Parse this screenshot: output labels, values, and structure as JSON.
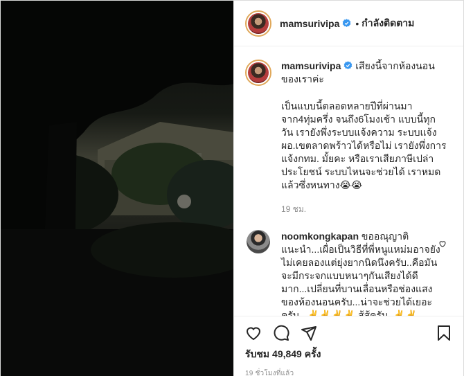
{
  "header": {
    "username": "mamsurivipa",
    "separator": "•",
    "follow_label": "กำลังติดตาม"
  },
  "caption": {
    "username": "mamsurivipa",
    "first_line": "เสียงนี้จากห้องนอนของเราค่ะ",
    "body": "เป็นแบบนี้ตลอดหลายปีที่ผ่านมา จาก4ทุ่มครึ่ง จนถึง6โมงเช้า แบบนี้ทุกวัน เรายังพึ่งระบบแจ้งความ ระบบแจ้งผอ.เขตลาดพร้าวได้หรือไม่ เรายังพึ่งการแจ้งกทม. มั้ยคะ หรือเราเสียภาษีเปล่าประโยชน์ ระบบไหนจะช่วยได้ เราหมดแล้วซึ่งหนทาง😭😭",
    "time": "19 ชม."
  },
  "comment": {
    "username": "noomkongkapan",
    "text": "ขออณุญาติแนะนำ...เผื่อเป็นวิธีที่พี่หนูแหม่มอาจยังไม่เคยลองแต่ยุ่งยากนิดนึงครับ..คือมันจะมีกระจกแบบหนาๆกันเสียงได้ดีมาก...เปลี่ยนที่บานเลื่อนหรือช่องแสงของห้องนอนครับ...น่าจะช่วยได้เยอะครับ...✌️✌️✌️✌️ สู้สู้ครับ..✌️✌️"
  },
  "actions": {
    "likes_label": "รับชม 49,849 ครั้ง",
    "posted_ago": "19 ชั่วโมงที่แล้ว"
  },
  "icons": [
    "verified-badge-icon",
    "heart-icon",
    "comment-icon",
    "share-icon",
    "bookmark-icon"
  ],
  "colors": {
    "verified": "#3897f0",
    "meta": "#8e8e8e",
    "text": "#262626"
  }
}
